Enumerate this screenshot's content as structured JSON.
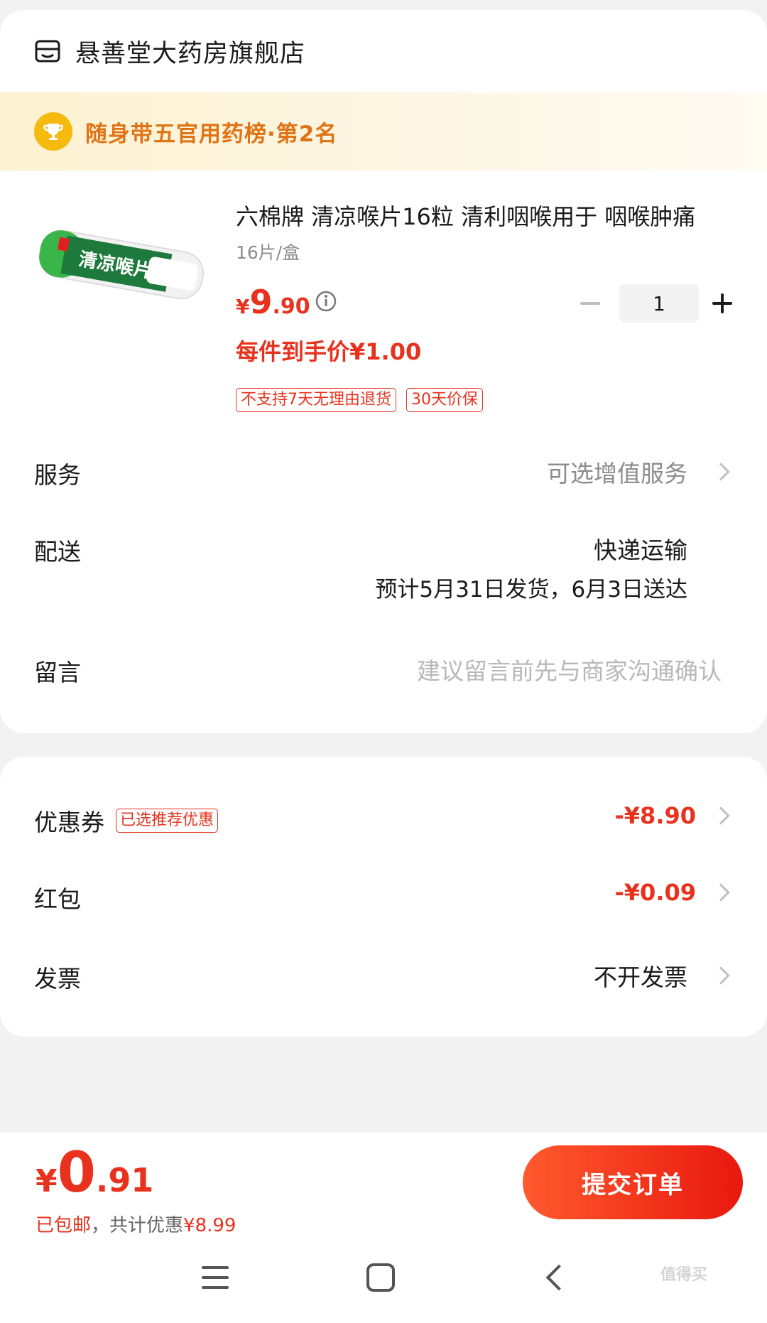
{
  "shop": {
    "name": "悬善堂大药房旗舰店"
  },
  "rank_banner": {
    "text": "随身带五官用药榜·第2名"
  },
  "product": {
    "title": "六棉牌 清凉喉片16粒 清利咽喉用于 咽喉肿痛",
    "image_text": "清凉喉片",
    "spec": "16片/盒",
    "price_symbol": "¥",
    "price_int": "9",
    "price_dec": ".90",
    "quantity": "1",
    "unit_price": "每件到手价¥1.00",
    "tags": [
      "不支持7天无理由退货",
      "30天价保"
    ]
  },
  "service": {
    "label": "服务",
    "value": "可选增值服务"
  },
  "delivery": {
    "label": "配送",
    "method": "快递运输",
    "eta": "预计5月31日发货，6月3日送达"
  },
  "message": {
    "label": "留言",
    "placeholder": "建议留言前先与商家沟通确认"
  },
  "coupon": {
    "label": "优惠券",
    "badge": "已选推荐优惠",
    "value": "-¥8.90"
  },
  "red_packet": {
    "label": "红包",
    "value": "-¥0.09"
  },
  "invoice": {
    "label": "发票",
    "value": "不开发票"
  },
  "footer": {
    "total_symbol": "¥",
    "total_int": "0",
    "total_dec": ".91",
    "shipping": "已包邮",
    "discount_prefix": "，共计优惠",
    "discount_value": "¥8.99",
    "submit": "提交订单"
  },
  "watermark": "值得买"
}
